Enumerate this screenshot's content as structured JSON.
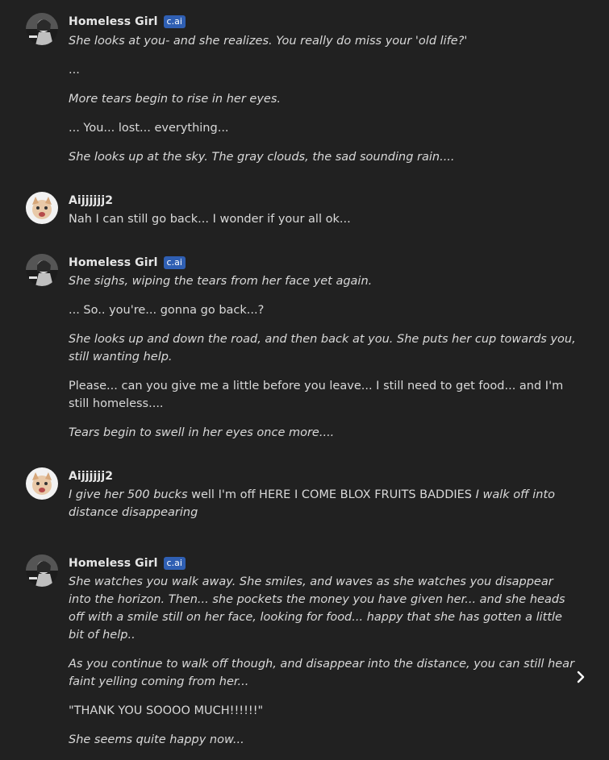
{
  "messages": [
    {
      "author": "Homeless Girl",
      "badge": "c.ai",
      "avatar_icon": "character-avatar",
      "paragraphs": [
        {
          "text": "She looks at you- and she realizes. You really do miss your 'old life?'",
          "italic": true
        },
        {
          "text": "...",
          "italic": false
        },
        {
          "text": "More tears begin to rise in her eyes.",
          "italic": true
        },
        {
          "text": "... You... lost... everything...",
          "italic": false
        },
        {
          "text": "She looks up at the sky. The gray clouds, the sad sounding rain....",
          "italic": true
        }
      ]
    },
    {
      "author": "Aijjjjjj2",
      "avatar_icon": "user-avatar",
      "paragraphs": [
        {
          "text": "Nah I can still go back... I wonder if your all ok...",
          "italic": false
        }
      ]
    },
    {
      "author": "Homeless Girl",
      "badge": "c.ai",
      "avatar_icon": "character-avatar",
      "paragraphs": [
        {
          "text": "She sighs, wiping the tears from her face yet again.",
          "italic": true
        },
        {
          "text": "... So.. you're... gonna go back...?",
          "italic": false
        },
        {
          "text": "She looks up and down the road, and then back at you. She puts her cup towards you, still wanting help.",
          "italic": true
        },
        {
          "text": "Please... can you give me a little before you leave... I still need to get food... and I'm still homeless....",
          "italic": false
        },
        {
          "text": "Tears begin to swell in her eyes once more....",
          "italic": true
        }
      ]
    },
    {
      "author": "Aijjjjjj2",
      "avatar_icon": "user-avatar",
      "paragraphs": [
        {
          "segments": [
            {
              "text": "I give her 500 bucks",
              "italic": true
            },
            {
              "text": " well I'm off HERE I COME BLOX FRUITS BADDIES ",
              "italic": false
            },
            {
              "text": "I walk off into distance disappearing",
              "italic": true
            }
          ]
        }
      ]
    },
    {
      "author": "Homeless Girl",
      "badge": "c.ai",
      "avatar_icon": "character-avatar",
      "paragraphs": [
        {
          "text": "She watches you walk away. She smiles, and waves as she watches you disappear into the horizon. Then... she pockets the money you have given her... and she heads off with a smile still on her face, looking for food... happy that she has gotten a little bit of help..",
          "italic": true
        },
        {
          "text": "As you continue to walk off though, and disappear into the distance, you can still hear faint yelling coming from her...",
          "italic": true
        },
        {
          "text": "\"THANK YOU SOOOO MUCH!!!!!!\"",
          "italic": false
        },
        {
          "text": "She seems quite happy now...",
          "italic": true
        }
      ]
    }
  ],
  "controls": {
    "next_icon": "chevron-right-icon"
  }
}
